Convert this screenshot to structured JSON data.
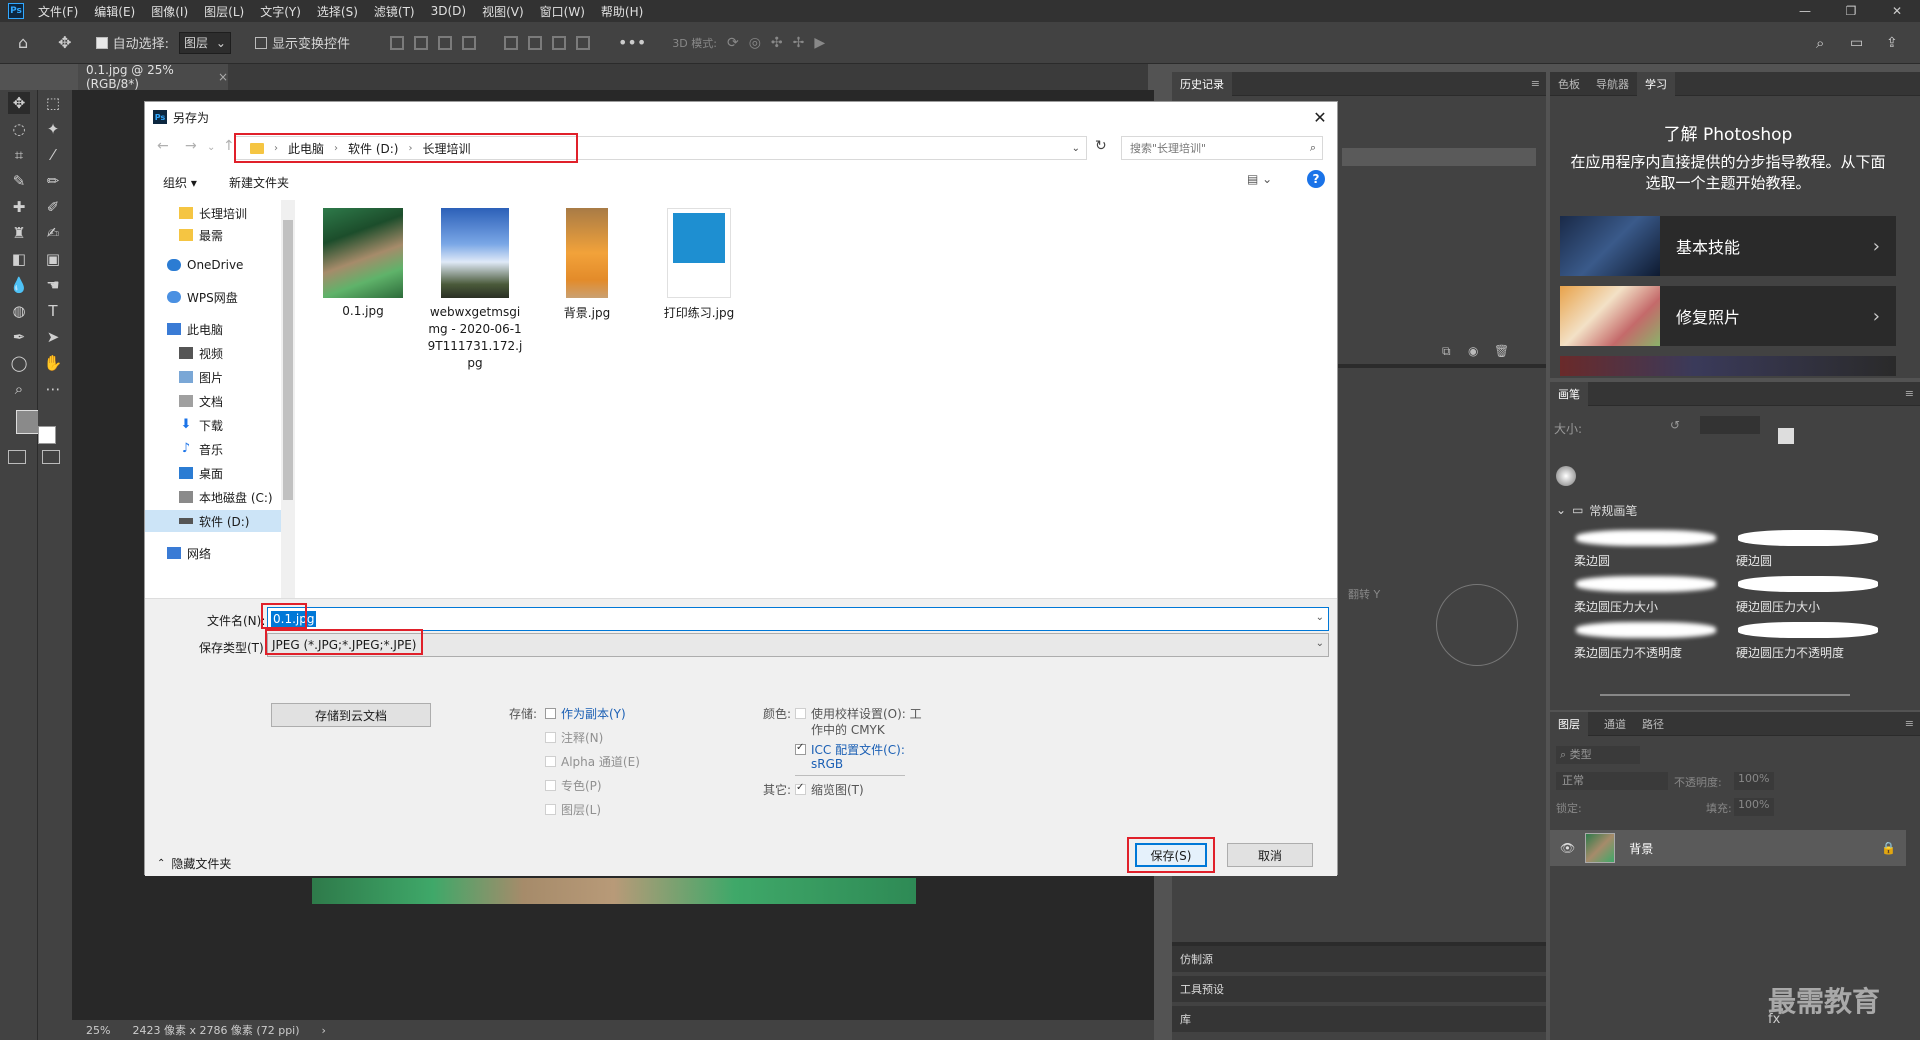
{
  "menubar": {
    "items": [
      "文件(F)",
      "编辑(E)",
      "图像(I)",
      "图层(L)",
      "文字(Y)",
      "选择(S)",
      "滤镜(T)",
      "3D(D)",
      "视图(V)",
      "窗口(W)",
      "帮助(H)"
    ]
  },
  "optbar": {
    "auto_select": "自动选择:",
    "layer_select": "图层",
    "show_transform": "显示变换控件",
    "mode_3d": "3D 模式:"
  },
  "doc_tab": "0.1.jpg @ 25%(RGB/8*)",
  "status": {
    "zoom": "25%",
    "info": "2423 像素 x 2786 像素 (72 ppi)"
  },
  "panels": {
    "history": "历史记录",
    "learn_tabs": [
      "色板",
      "导航器",
      "学习"
    ],
    "learn_title": "了解 Photoshop",
    "learn_desc": "在应用程序内直接提供的分步指导教程。从下面选取一个主题开始教程。",
    "learn_cards": [
      "基本技能",
      "修复照片"
    ],
    "brush_panel": "画笔",
    "brush_size": "大小:",
    "brush_group": "常规画笔",
    "brushes": [
      "柔边圆",
      "硬边圆",
      "柔边圆压力大小",
      "硬边圆压力大小",
      "柔边圆压力不透明度",
      "硬边圆压力不透明度"
    ],
    "layer_tabs": [
      "图层",
      "通道",
      "路径"
    ],
    "layer_kind": "类型",
    "blend_mode": "正常",
    "opacity_label": "不透明度:",
    "opacity_value": "100%",
    "lock_label": "锁定:",
    "fill_label": "填充:",
    "fill_value": "100%",
    "layer_name": "背景",
    "clone_source": "仿制源",
    "tool_presets": "工具预设",
    "library": "库",
    "flip_y": "翻转 Y"
  },
  "watermark": "最需教育",
  "dialog": {
    "title": "另存为",
    "breadcrumb": [
      "此电脑",
      "软件 (D:)",
      "长理培训"
    ],
    "search_placeholder": "搜索\"长理培训\"",
    "organize": "组织 ▾",
    "new_folder": "新建文件夹",
    "nav": [
      "长理培训",
      "最需",
      "OneDrive",
      "WPS网盘",
      "此电脑",
      "视频",
      "图片",
      "文档",
      "下载",
      "音乐",
      "桌面",
      "本地磁盘 (C:)",
      "软件 (D:)",
      "网络"
    ],
    "files": [
      "0.1.jpg",
      "webwxgetmsgimg - 2020-06-19T111731.172.jpg",
      "背景.jpg",
      "打印练习.jpg"
    ],
    "filename_label": "文件名(N):",
    "filename_value": "0.1.jpg",
    "filetype_label": "保存类型(T):",
    "filetype_value": "JPEG (*.JPG;*.JPEG;*.JPE)",
    "save_cloud": "存储到云文档",
    "save_section": "存储:",
    "save_opts": [
      "作为副本(Y)",
      "注释(N)",
      "Alpha 通道(E)",
      "专色(P)",
      "图层(L)"
    ],
    "color_section": "颜色:",
    "proof_label": "使用校样设置(O): 工",
    "proof_label2": "作中的 CMYK",
    "icc_label": "ICC 配置文件(C):",
    "icc_value": "sRGB",
    "other_section": "其它:",
    "thumbnail": "缩览图(T)",
    "hide_folders": "隐藏文件夹",
    "save_btn": "保存(S)",
    "cancel_btn": "取消"
  }
}
